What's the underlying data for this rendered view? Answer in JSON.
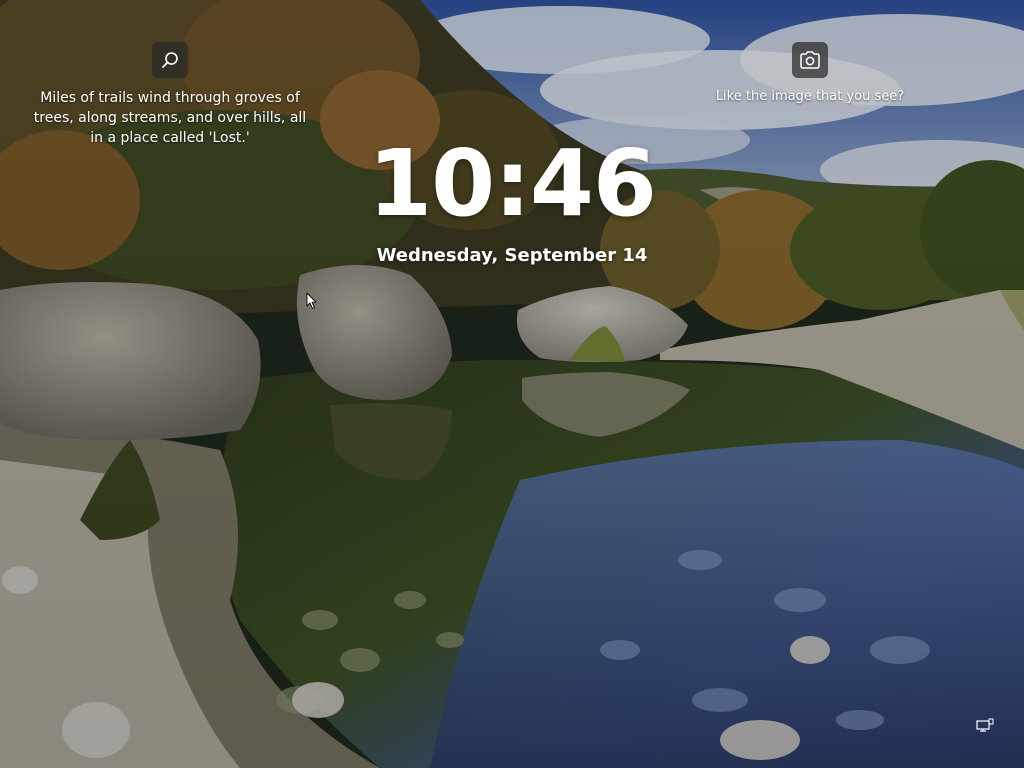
{
  "lock_screen": {
    "time": "10:46",
    "date": "Wednesday, September 14"
  },
  "spotlight": {
    "fact_text": "Miles of trails wind through groves of trees, along streams, and over hills, all in a place called 'Lost.'",
    "fact_icon": "search-icon",
    "like_text": "Like the image that you see?",
    "like_icon": "camera-icon"
  },
  "status": {
    "network_icon": "network-icon"
  },
  "colors": {
    "text": "#ffffff",
    "icon_bg": "#282828"
  }
}
